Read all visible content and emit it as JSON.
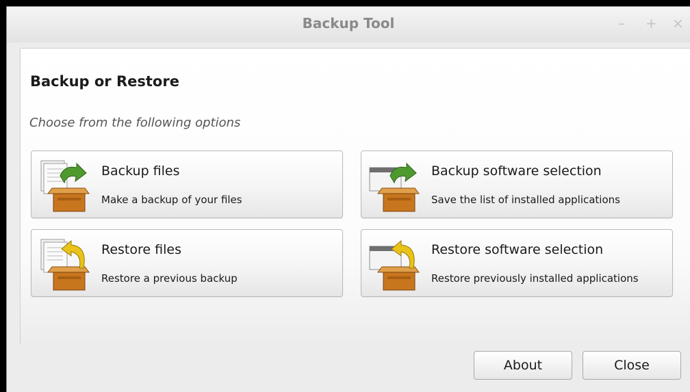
{
  "window": {
    "title": "Backup Tool",
    "controls": {
      "minimize": "–",
      "maximize": "+",
      "close": "×"
    }
  },
  "main": {
    "heading": "Backup or Restore",
    "subheading": "Choose from the following options",
    "options": [
      {
        "title": "Backup files",
        "description": "Make a backup of your files",
        "icon": "backup-files-icon"
      },
      {
        "title": "Backup software selection",
        "description": "Save the list of installed applications",
        "icon": "backup-software-icon"
      },
      {
        "title": "Restore files",
        "description": "Restore a previous backup",
        "icon": "restore-files-icon"
      },
      {
        "title": "Restore software selection",
        "description": "Restore previously installed applications",
        "icon": "restore-software-icon"
      }
    ]
  },
  "footer": {
    "about_label": "About",
    "close_label": "Close"
  },
  "colors": {
    "backup_arrow": "#4f9a2e",
    "restore_arrow": "#e9c21a",
    "box": "#c8761e"
  }
}
